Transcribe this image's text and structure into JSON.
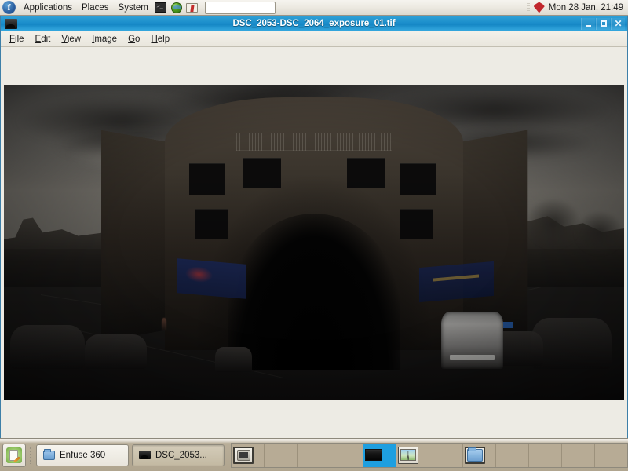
{
  "top_panel": {
    "logo_text": "f",
    "logo_name": "fedora-logo",
    "menus": [
      "Applications",
      "Places",
      "System"
    ],
    "launchers": [
      {
        "name": "terminal-launcher-icon",
        "label": "Terminal"
      },
      {
        "name": "web-browser-launcher-icon",
        "label": "Web Browser"
      },
      {
        "name": "help-launcher-icon",
        "label": "Help"
      }
    ],
    "clock": "Mon 28 Jan, 21:49",
    "tray_icon_name": "ruby-gem-tray-icon"
  },
  "window": {
    "title": "DSC_2053-DSC_2064_exposure_01.tif",
    "icon_name": "image-file-icon",
    "controls": [
      {
        "name": "minimize-button",
        "glyph": "_"
      },
      {
        "name": "maximize-button",
        "glyph": "□"
      },
      {
        "name": "close-button",
        "glyph": "×"
      }
    ],
    "menubar": [
      {
        "label": "File",
        "mnemonic": "F"
      },
      {
        "label": "Edit",
        "mnemonic": "E"
      },
      {
        "label": "View",
        "mnemonic": "V"
      },
      {
        "label": "Image",
        "mnemonic": "I"
      },
      {
        "label": "Go",
        "mnemonic": "G"
      },
      {
        "label": "Help",
        "mnemonic": "H"
      }
    ],
    "image": {
      "name": "panorama-photograph",
      "description": "Dark under-exposed 360 panoramic photograph of a curved stone building facade with an arched entrance, overcast cloudy sky, parked cars on the left, a white van on the right, and a wet street in the foreground"
    }
  },
  "bottom_panel": {
    "show_desktop_icon_name": "show-desktop-button",
    "tasks": [
      {
        "label": "Enfuse 360",
        "icon": "folder-icon",
        "state": "inactive"
      },
      {
        "label": "DSC_2053...",
        "icon": "image-file-icon",
        "state": "active"
      }
    ],
    "pager": {
      "workspace_count": 12,
      "current_workspace": 5,
      "thumbnails": [
        {
          "workspace": 1,
          "name": "mini-terminal-window"
        },
        {
          "workspace": 5,
          "name": "mini-image-window"
        },
        {
          "workspace": 6,
          "name": "mini-panorama-window"
        },
        {
          "workspace": 8,
          "name": "mini-folder-window"
        }
      ]
    }
  },
  "colors": {
    "titlebar_blue": "#1b8ecb",
    "panel_beige": "#b0a58f",
    "panel_light": "#ece9e1",
    "pager_current": "#1e9fe0",
    "canvas_bg": "#edebe4"
  }
}
